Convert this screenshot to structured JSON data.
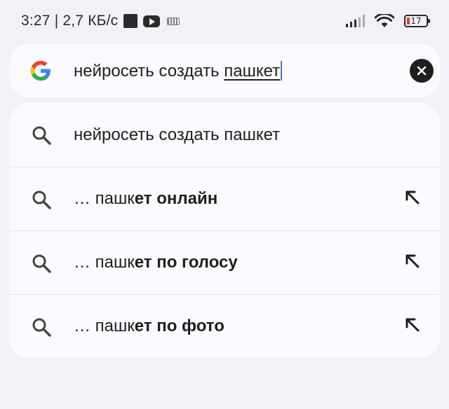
{
  "status_bar": {
    "time_speed": "3:27 | 2,7 КБ/с",
    "battery": "17",
    "icons": [
      "app-square-icon",
      "youtube-icon",
      "keyboard-icon",
      "signal-icon",
      "wifi-icon",
      "battery-icon"
    ],
    "battery_color": "#e53935"
  },
  "search": {
    "query_prefix": "нейросеть создать ",
    "query_underlined": "пашкет",
    "logo": "google-g-logo",
    "clear_icon": "clear-icon"
  },
  "suggestions": [
    {
      "prefix": "нейросеть создать пашкет",
      "bold": "",
      "has_fill": false
    },
    {
      "prefix": "… пашк",
      "bold": "ет онлайн",
      "has_fill": true
    },
    {
      "prefix": "… пашк",
      "bold": "ет по голосу",
      "has_fill": true
    },
    {
      "prefix": "… пашк",
      "bold": "ет по фото",
      "has_fill": true
    }
  ],
  "colors": {
    "background": "#f2f1f8",
    "card": "#fbfaff",
    "caret": "#5b6fd6"
  }
}
